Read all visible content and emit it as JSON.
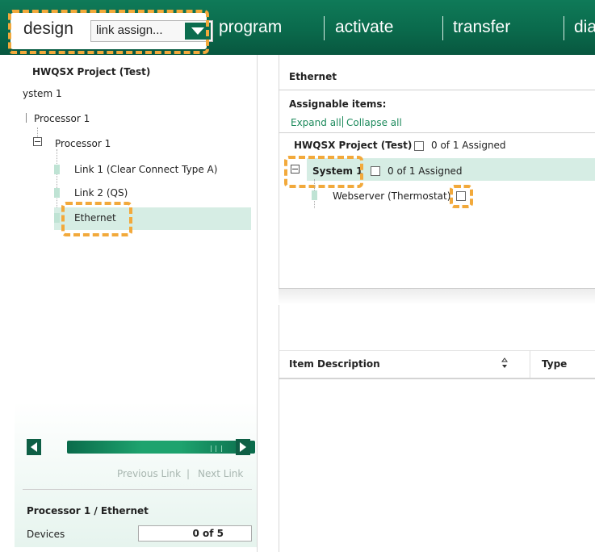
{
  "topbar": {
    "design": "design",
    "dropdown_value": "link assign...",
    "tabs": [
      "program",
      "activate",
      "transfer",
      "dia"
    ]
  },
  "left_tree": {
    "project": "HWQSX Project (Test)",
    "system": "ystem 1",
    "processor_group": "Processor 1",
    "processor": "Processor 1",
    "links": [
      "Link 1 (Clear Connect Type A)",
      "Link 2 (QS)",
      "Ethernet"
    ]
  },
  "link_nav": {
    "previous": "Previous Link",
    "separator": "|",
    "next": "Next Link"
  },
  "summary": {
    "title": "Processor 1 / Ethernet",
    "devices_label": "Devices",
    "devices_value": "0 of 5"
  },
  "right": {
    "header": "Ethernet",
    "assignable_label": "Assignable items:",
    "expand_all": "Expand all",
    "collapse_all": "Collapse all",
    "project": "HWQSX Project (Test)",
    "project_assigned": "0 of 1 Assigned",
    "system": "System 1",
    "system_assigned": "0 of 1 Assigned",
    "item": "Webserver (Thermostat)",
    "table_columns": [
      "Item Description",
      "Type"
    ]
  },
  "colors": {
    "brand_green": "#0a6b4b",
    "highlight": "#f2a93b",
    "selection": "#d6ede4",
    "link": "#1d8a5c"
  },
  "icons": [
    "dropdown-arrow-icon",
    "expand-icon",
    "collapse-icon",
    "scroll-left-icon",
    "scroll-right-icon",
    "sort-icon"
  ]
}
